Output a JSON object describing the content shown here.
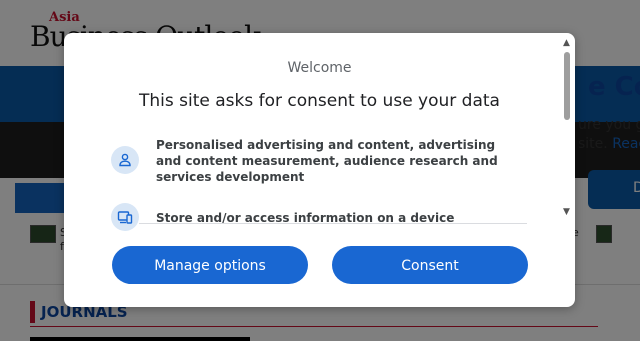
{
  "site": {
    "logo_small": "Asia",
    "logo_main": "Business Outlook",
    "story_left_line1": "S",
    "story_left_line2": "f",
    "story_right": "e",
    "journals": "JOURNALS"
  },
  "cookie_banner": {
    "title": "e Coo",
    "text_line1": "ure you ge",
    "text_line2_prefix": "site. ",
    "text_line2_link": "Reac",
    "button": "D"
  },
  "dialog": {
    "welcome": "Welcome",
    "heading": "This site asks for consent to use your data",
    "purposes": [
      {
        "icon": "person-icon",
        "text": "Personalised advertising and content, advertising and content measurement, audience research and services development"
      },
      {
        "icon": "devices-icon",
        "text": "Store and/or access information on a device"
      }
    ],
    "manage_button": "Manage options",
    "consent_button": "Consent"
  },
  "colors": {
    "primary": "#1967d2",
    "brand_red": "#c8102e",
    "brand_blue": "#0a5aa8"
  }
}
